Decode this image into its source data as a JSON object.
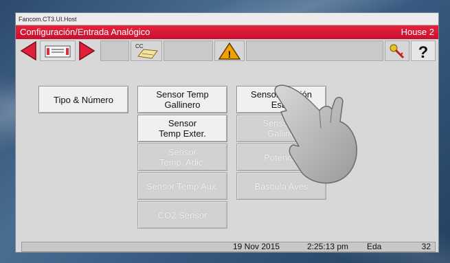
{
  "window": {
    "title": "Fancom.CT3.UI.Host"
  },
  "header": {
    "title": "Configuración/Entrada Analógico",
    "house": "House 2"
  },
  "toolbar": {
    "icons": [
      "arrow-left-icon",
      "card-icon",
      "arrow-right-icon",
      "cc-keyboard-icon",
      "warning-icon",
      "key-icon",
      "help-icon"
    ],
    "cc_label": "CC",
    "help_label": "?",
    "warning_mark": "!"
  },
  "buttons": {
    "tipo_numero": "Tipo & Número",
    "sensor_temp_gallinero_l1": "Sensor Temp",
    "sensor_temp_gallinero_l2": "Gallinero",
    "sensor_presion_l1": "Sensor Presión",
    "sensor_presion_l2": "Estát",
    "sensor_temp_exter_l1": "Sensor",
    "sensor_temp_exter_l2": "Temp Exter.",
    "sensor_h_l1": "Sensor H",
    "sensor_h_l2": "Galline",
    "sensor_temp_adic_l1": "Sensor",
    "sensor_temp_adic_l2": "Temp. Adic.",
    "potenciometro": "Potenció",
    "sensor_temp_aux": "Sensor Temp Aux.",
    "bascula_aves": "Báscula Aves",
    "co2_sensor": "CO2 Sensor"
  },
  "status": {
    "date": "19 Nov 2015",
    "time": "2:25:13 pm",
    "user": "Eda",
    "number": "32"
  },
  "colors": {
    "header": "#c8102e",
    "arrow": "#e0203a",
    "warning": "#f0a000",
    "disabled_text": "#f4f4f4"
  }
}
